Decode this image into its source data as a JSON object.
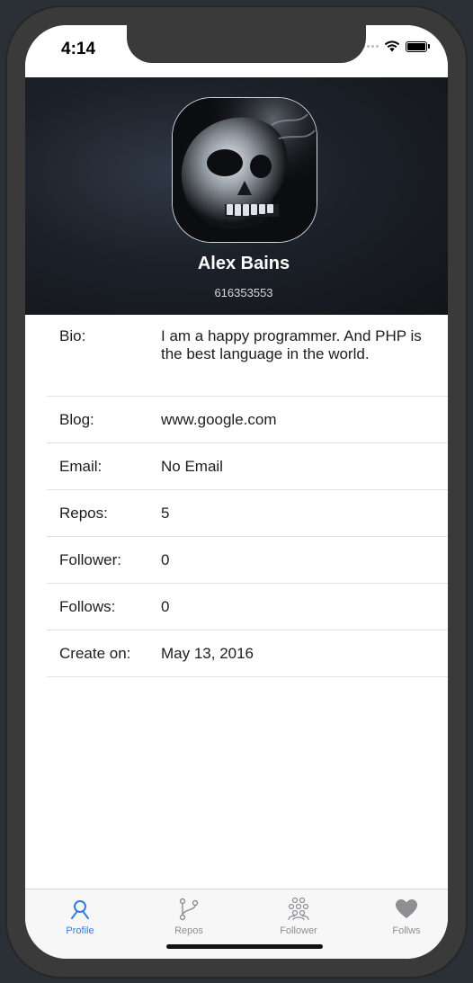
{
  "status_bar": {
    "time": "4:14"
  },
  "profile": {
    "name": "Alex Bains",
    "id": "616353553"
  },
  "info_rows": [
    {
      "label": "Bio:",
      "value": "I am a happy programmer. And PHP is the best language in the world."
    },
    {
      "label": "Blog:",
      "value": "www.google.com"
    },
    {
      "label": "Email:",
      "value": "No Email"
    },
    {
      "label": "Repos:",
      "value": "5"
    },
    {
      "label": "Follower:",
      "value": "0"
    },
    {
      "label": "Follows:",
      "value": "0"
    },
    {
      "label": "Create on:",
      "value": "May 13, 2016"
    }
  ],
  "tabs": [
    {
      "label": "Profile",
      "icon": "profile-icon",
      "active": true
    },
    {
      "label": "Repos",
      "icon": "repo-branch-icon",
      "active": false
    },
    {
      "label": "Follower",
      "icon": "followers-group-icon",
      "active": false
    },
    {
      "label": "Follws",
      "icon": "heart-icon",
      "active": false
    }
  ],
  "colors": {
    "tab_active": "#2f7de1",
    "tab_inactive": "#8e8e93",
    "header_bg": "#1c2129"
  }
}
